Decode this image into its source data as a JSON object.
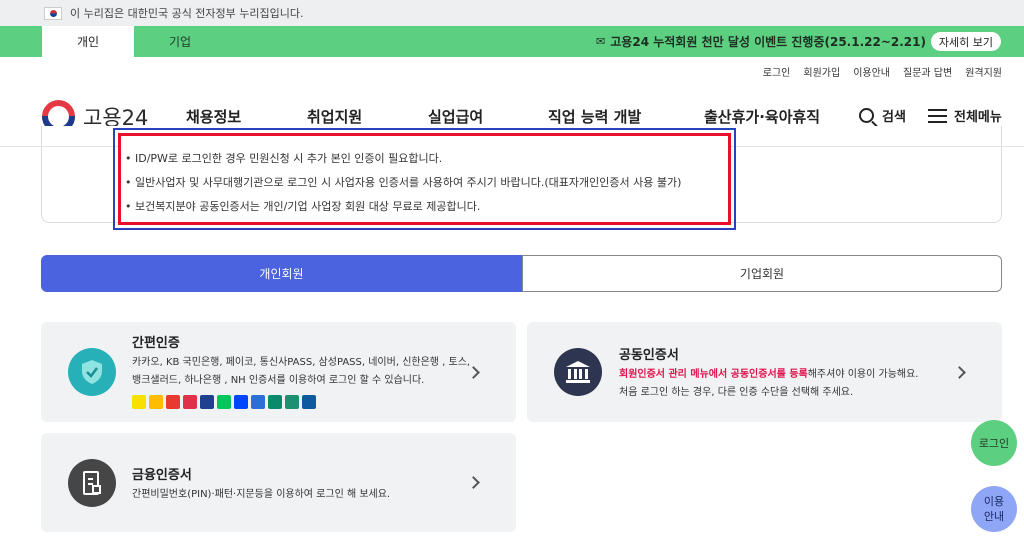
{
  "gov_banner": {
    "text": "이 누리집은 대한민국 공식 전자정부 누리집입니다."
  },
  "top_tabs": {
    "personal": "개인",
    "business": "기업"
  },
  "event": {
    "text": "고용24 누적회원 천만 달성 이벤트 진행중(25.1.22~2.21)",
    "button": "자세히 보기"
  },
  "util_links": [
    "로그인",
    "회원가입",
    "이용안내",
    "질문과 답변",
    "원격지원"
  ],
  "logo": {
    "text": "고용24"
  },
  "nav": [
    "채용정보",
    "취업지원",
    "실업급여",
    "직업 능력 개발",
    "출산휴가·육아휴직"
  ],
  "search_label": "검색",
  "menu_label": "전체메뉴",
  "notice": [
    "• ID/PW로 로그인한 경우 민원신청 시 추가 본인 인증이 필요합니다.",
    "• 일반사업자 및 사무대행기관으로 로그인 시 사업자용 인증서를 사용하여 주시기 바랍니다.(대표자개인인증서 사용 불가)",
    "• 보건복지분야 공동인증서는 개인/기업 사업장 회원 대상 무료로 제공합니다."
  ],
  "member_toggle": {
    "personal": "개인회원",
    "business": "기업회원"
  },
  "cards": {
    "simple": {
      "title": "간편인증",
      "desc1": "카카오, KB 국민은행, 페이코, 통신사PASS, 삼성PASS, 네이버, 신한은행 , 토스,",
      "desc2": "뱅크샐러드, 하나은행 , NH 인증서를 이용하여 로그인 할 수 있습니다."
    },
    "cert": {
      "title": "공동인증서",
      "desc1_highlight": "회원인증서 관리 메뉴에서 공동인증서를 등록",
      "desc1_rest": "해주셔야 이용이 가능해요.",
      "desc2": "처음 로그인 하는 경우, 다른 인증 수단을 선택해 주세요."
    },
    "financial": {
      "title": "금융인증서",
      "desc": "간편비밀번호(PIN)·패턴·지문등을 이용하여 로그인 해 보세요."
    }
  },
  "bank_icon_colors": [
    "#f9e000",
    "#ffbc00",
    "#e83a2e",
    "#e0314b",
    "#1f3f8f",
    "#03c75a",
    "#0046ff",
    "#2c6fd6",
    "#0a8a6a",
    "#1e8f70",
    "#0f5a9e"
  ],
  "floating": {
    "login": "로그인",
    "guide_line1": "이용",
    "guide_line2": "안내"
  },
  "colors": {
    "green": "#5ccf80",
    "primary": "#4c63e0",
    "notice_red": "#e8102b",
    "notice_blue": "#2c3fbf"
  }
}
